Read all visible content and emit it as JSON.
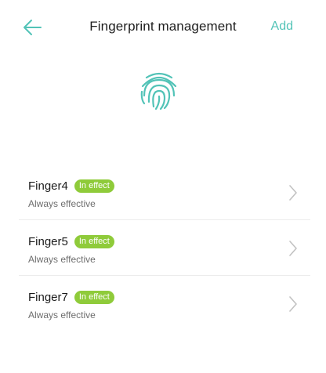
{
  "header": {
    "title": "Fingerprint management",
    "add_label": "Add"
  },
  "colors": {
    "accent": "#52c3b7",
    "badge": "#8fcb3a"
  },
  "icons": {
    "back": "arrow-left-icon",
    "hero": "fingerprint-icon",
    "chevron": "chevron-right-icon"
  },
  "fingers": [
    {
      "name": "Finger4",
      "status": "In effect",
      "detail": "Always effective"
    },
    {
      "name": "Finger5",
      "status": "In effect",
      "detail": "Always effective"
    },
    {
      "name": "Finger7",
      "status": "In effect",
      "detail": "Always effective"
    }
  ]
}
